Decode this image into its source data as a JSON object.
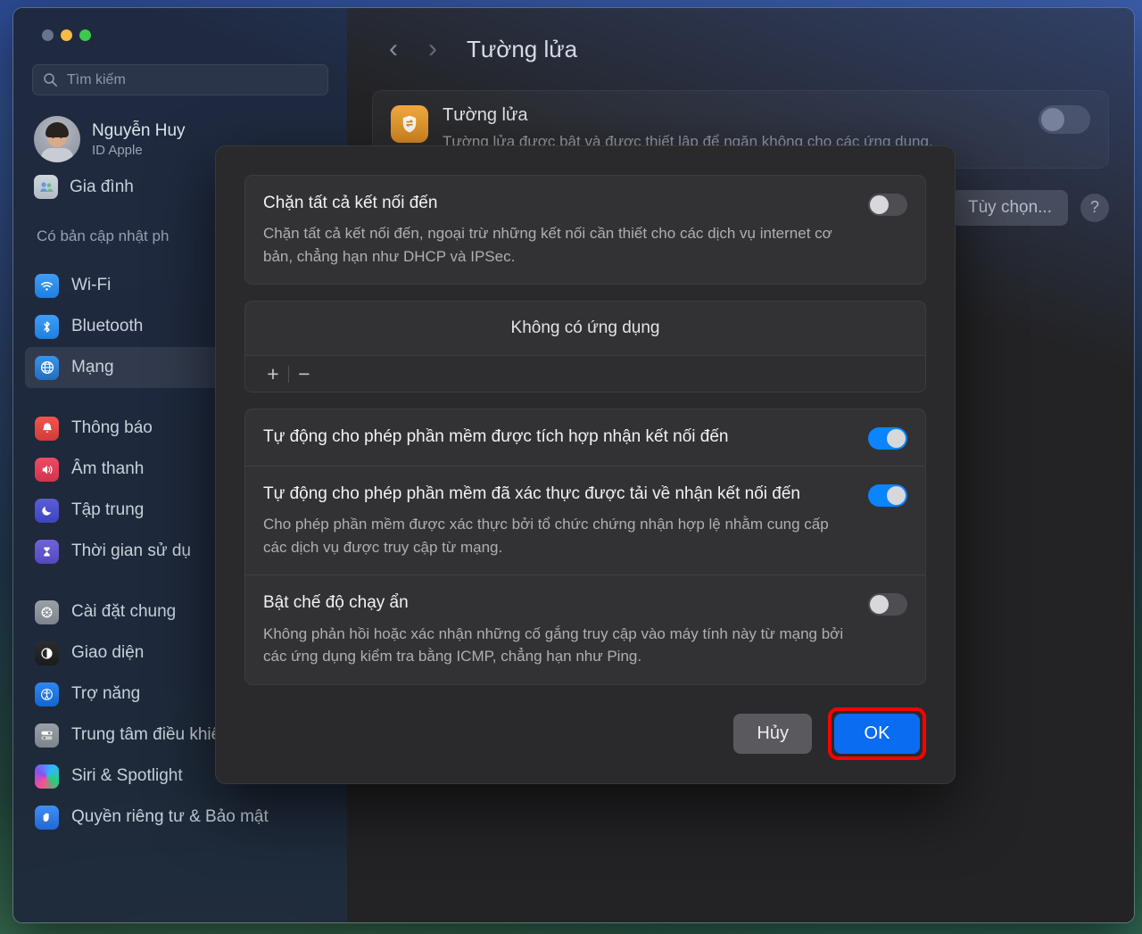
{
  "window": {
    "traffic_lights": [
      "close",
      "minimize",
      "zoom"
    ]
  },
  "sidebar": {
    "search": {
      "placeholder": "Tìm kiếm",
      "icon": "search-icon"
    },
    "account": {
      "name": "Nguyễn Huy",
      "subtitle": "ID Apple"
    },
    "family": {
      "label": "Gia đình",
      "icon": "family-icon"
    },
    "update_note": "Có bản cập nhật ph",
    "items": [
      {
        "label": "Wi-Fi",
        "icon": "wifi-icon",
        "selected": false
      },
      {
        "label": "Bluetooth",
        "icon": "bluetooth-icon",
        "selected": false
      },
      {
        "label": "Mạng",
        "icon": "network-globe-icon",
        "selected": true
      },
      {
        "label": "Thông báo",
        "icon": "notifications-bell-icon",
        "selected": false
      },
      {
        "label": "Âm thanh",
        "icon": "sound-speaker-icon",
        "selected": false
      },
      {
        "label": "Tập trung",
        "icon": "focus-moon-icon",
        "selected": false
      },
      {
        "label": "Thời gian sử dụ",
        "icon": "screen-time-hourglass-icon",
        "selected": false
      },
      {
        "label": "Cài đặt chung",
        "icon": "general-gear-icon",
        "selected": false
      },
      {
        "label": "Giao diện",
        "icon": "appearance-contrast-icon",
        "selected": false
      },
      {
        "label": "Trợ năng",
        "icon": "accessibility-icon",
        "selected": false
      },
      {
        "label": "Trung tâm điều khiển",
        "icon": "control-center-icon",
        "selected": false
      },
      {
        "label": "Siri & Spotlight",
        "icon": "siri-icon",
        "selected": false
      },
      {
        "label": "Quyền riêng tư & Bảo mật",
        "icon": "privacy-hand-icon",
        "selected": false
      }
    ]
  },
  "detail": {
    "nav": {
      "back_icon": "chevron-left-icon",
      "forward_icon": "chevron-right-icon"
    },
    "title": "Tường lửa",
    "firewall_card": {
      "icon": "firewall-shield-icon",
      "title": "Tường lửa",
      "description": "Tường lửa được bật và được thiết lập để ngăn không cho các ứng dụng,",
      "toggle_on": true
    },
    "options_button": "Tùy chọn...",
    "help_button": "?"
  },
  "sheet": {
    "block_all": {
      "title": "Chặn tất cả kết nối đến",
      "description": "Chặn tất cả kết nối đến, ngoại trừ những kết nối cần thiết cho các dịch vụ internet cơ bản, chẳng hạn như DHCP và IPSec.",
      "toggle_on": false
    },
    "app_list": {
      "empty_text": "Không có ứng dụng",
      "add_label": "+",
      "remove_label": "−"
    },
    "allow_builtin": {
      "title": "Tự động cho phép phần mềm được tích hợp nhận kết nối đến",
      "toggle_on": true
    },
    "allow_signed": {
      "title": "Tự động cho phép phần mềm đã xác thực được tải về nhận kết nối đến",
      "description": "Cho phép phần mềm được xác thực bởi tổ chức chứng nhận hợp lệ nhằm cung cấp các dịch vụ được truy cập từ mạng.",
      "toggle_on": true
    },
    "stealth_mode": {
      "title": "Bật chế độ chạy ẩn",
      "description": "Không phản hồi hoặc xác nhận những cố gắng truy cập vào máy tính này từ mạng bởi các ứng dụng kiểm tra bằng ICMP, chẳng hạn như Ping.",
      "toggle_on": false
    },
    "cancel_button": "Hủy",
    "ok_button": "OK",
    "highlight_color": "#ff0000"
  }
}
